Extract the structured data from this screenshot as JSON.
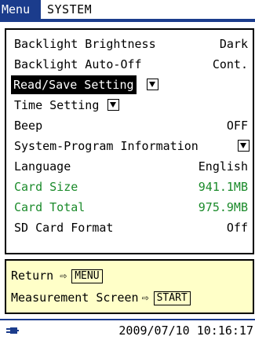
{
  "header": {
    "menu_tab": "Menu",
    "system_tab": "SYSTEM"
  },
  "settings": [
    {
      "label": "Backlight Brightness",
      "value": "Dark",
      "style": "normal",
      "dropdown": false
    },
    {
      "label": "Backlight Auto-Off",
      "value": "Cont.",
      "style": "normal",
      "dropdown": false
    },
    {
      "label": "Read/Save Setting",
      "value": "",
      "style": "selected",
      "dropdown": true
    },
    {
      "label": "Time Setting",
      "value": "",
      "style": "normal",
      "dropdown": true
    },
    {
      "label": "Beep",
      "value": "OFF",
      "style": "normal",
      "dropdown": false
    },
    {
      "label": "System-Program Information",
      "value": "",
      "style": "normal",
      "dropdown": true
    },
    {
      "label": "Language",
      "value": "English",
      "style": "normal",
      "dropdown": false
    },
    {
      "label": "Card Size",
      "value": "941.1MB",
      "style": "green",
      "dropdown": false
    },
    {
      "label": "Card Total",
      "value": "975.9MB",
      "style": "green",
      "dropdown": false
    },
    {
      "label": "SD Card Format",
      "value": "Off",
      "style": "normal",
      "dropdown": false
    }
  ],
  "help": {
    "return_label": "Return",
    "return_key": "MENU",
    "measure_label": "Measurement Screen",
    "measure_key": "START",
    "arrow_glyph": "⇨"
  },
  "status": {
    "datetime": "2009/07/10 10:16:17",
    "power_icon": "ac-plug-icon"
  },
  "colors": {
    "header_blue": "#1b3c8c",
    "help_bg": "#ffffc8",
    "info_green": "#1a8a2a"
  }
}
